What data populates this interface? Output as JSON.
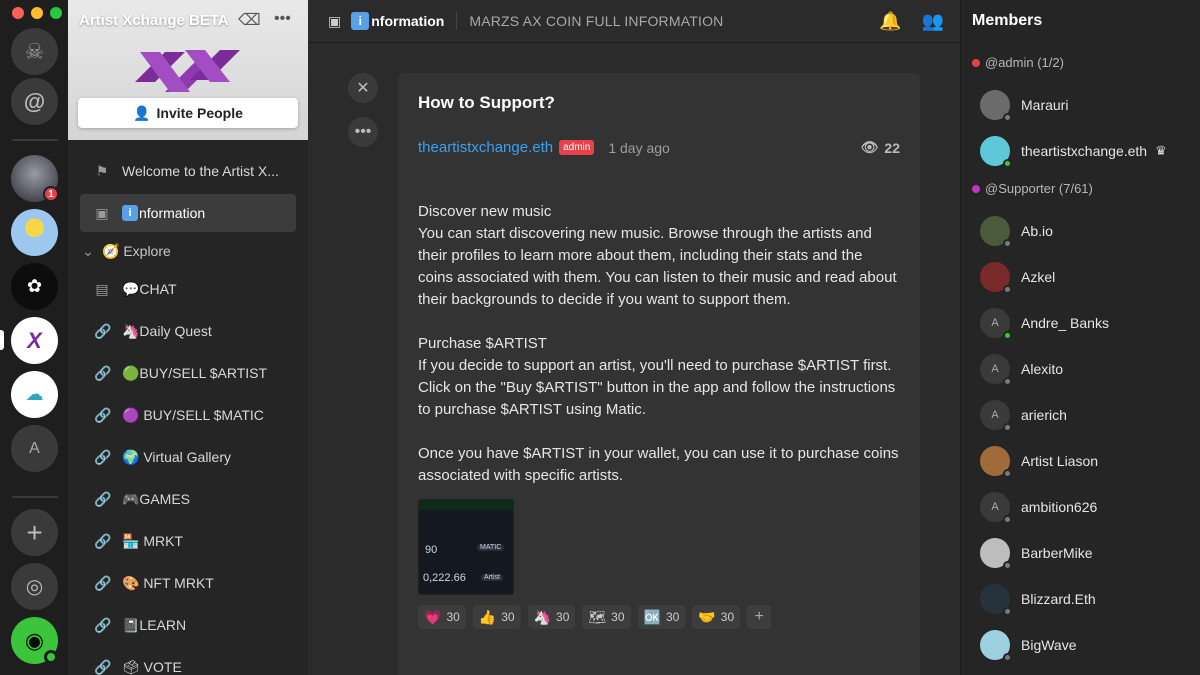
{
  "window": {
    "dots": [
      "#ff5f57",
      "#febc2e",
      "#28c840"
    ]
  },
  "rail": {
    "servers": [
      {
        "name": "home",
        "glyph": "☠"
      },
      {
        "name": "mentions",
        "glyph": "@"
      },
      {
        "name": "server-1",
        "badge": "1"
      },
      {
        "name": "server-2"
      },
      {
        "name": "server-3"
      },
      {
        "name": "artist-xchange",
        "glyph": "X"
      },
      {
        "name": "server-5"
      },
      {
        "name": "server-a",
        "glyph": "A"
      },
      {
        "name": "add",
        "glyph": "+"
      },
      {
        "name": "explore",
        "glyph": "◎"
      }
    ]
  },
  "sidebar": {
    "server_name": "Artist Xchange BETA",
    "invite_label": "Invite People",
    "channels": [
      {
        "icon": "⚑",
        "label": "Welcome to the Artist X..."
      },
      {
        "icon": "▣",
        "label": "nformation",
        "emoji": "i",
        "active": true
      },
      {
        "icon": "⌄",
        "label": "🧭 Explore",
        "category": true
      },
      {
        "icon": "▤",
        "label": "💬CHAT"
      },
      {
        "icon": "🔗",
        "label": "🦄Daily Quest"
      },
      {
        "icon": "🔗",
        "label": "🟢BUY/SELL $ARTIST"
      },
      {
        "icon": "🔗",
        "label": "🟣 BUY/SELL $MATIC"
      },
      {
        "icon": "🔗",
        "label": "🌍 Virtual Gallery"
      },
      {
        "icon": "🔗",
        "label": "🎮GAMES"
      },
      {
        "icon": "🔗",
        "label": "🏪 MRKT"
      },
      {
        "icon": "🔗",
        "label": "🎨 NFT MRKT"
      },
      {
        "icon": "🔗",
        "label": "📓LEARN"
      },
      {
        "icon": "🔗",
        "label": "🗳 VOTE"
      }
    ]
  },
  "header": {
    "channel_emoji": "i",
    "channel_title": "nformation",
    "topic": "MARZS AX COIN FULL INFORMATION"
  },
  "post": {
    "title": "How to Support?",
    "author": "theartistxchange.eth",
    "role": "admin",
    "time": "1 day ago",
    "views": "22",
    "paragraphs": [
      [
        "Discover new music",
        "You can start discovering new music. Browse through the artists and their profiles to learn more about them, including their stats and the coins associated with them. You can listen to their music and read about their backgrounds to decide if you want to support them."
      ],
      [
        "Purchase $ARTIST",
        "If you decide to support an artist, you'll need to purchase $ARTIST first. Click on the \"Buy $ARTIST\" button in the app and follow the instructions to purchase $ARTIST using Matic."
      ],
      [
        "Once you have $ARTIST in your wallet, you can use it to purchase coins associated with specific artists."
      ]
    ],
    "thumbnail": {
      "amount": "90",
      "token": "MATIC",
      "total": "0,222.66",
      "out": "Artist"
    },
    "reactions": [
      {
        "emoji": "💗",
        "count": "30"
      },
      {
        "emoji": "👍",
        "count": "30"
      },
      {
        "emoji": "🦄",
        "count": "30"
      },
      {
        "emoji": "🗺",
        "count": "30"
      },
      {
        "emoji": "🆗",
        "count": "30"
      },
      {
        "emoji": "🤝",
        "count": "30"
      }
    ]
  },
  "members": {
    "title": "Members",
    "sections": [
      {
        "label": "@admin (1/2)",
        "color": "#e7424c",
        "people": [
          {
            "name": "Marauri",
            "av": "#6b6b6b"
          },
          {
            "name": "theartistxchange.eth",
            "av": "#5ec8d8",
            "crown": true,
            "online": true
          }
        ]
      },
      {
        "label": "@Supporter (7/61)",
        "color": "#c533c5",
        "people": [
          {
            "name": "Ab.io",
            "av": "#4a5a3a"
          },
          {
            "name": "Azkel",
            "av": "#7a2a2a"
          },
          {
            "name": "Andre_ Banks",
            "letter": "A",
            "online": true
          },
          {
            "name": "Alexito",
            "letter": "A"
          },
          {
            "name": "arierich",
            "letter": "A"
          },
          {
            "name": "Artist Liason",
            "av": "#a06a3a"
          },
          {
            "name": "ambition626",
            "letter": "A"
          },
          {
            "name": "BarberMike",
            "av": "#bdbdbd"
          },
          {
            "name": "Blizzard.Eth",
            "av": "#26323c"
          },
          {
            "name": "BigWave",
            "av": "#9ad0e0"
          }
        ]
      }
    ]
  }
}
